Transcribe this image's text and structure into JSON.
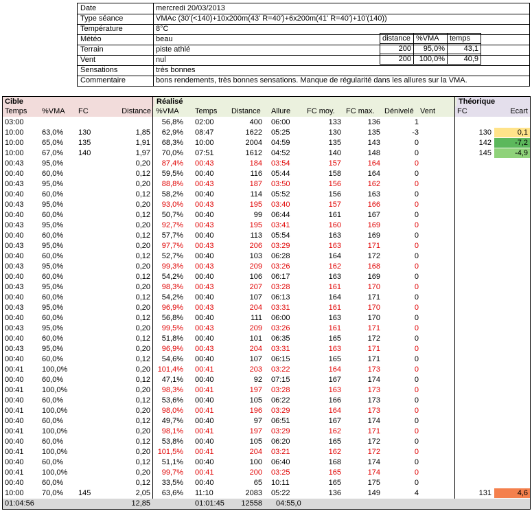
{
  "info": {
    "labels": [
      "Date",
      "Type séance",
      "Température",
      "Météo",
      "Terrain",
      "Vent",
      "Sensations",
      "Commentaire"
    ],
    "values": [
      "mercredi 20/03/2013",
      "VMAc (30'(<140)+10x200m(43' R=40')+6x200m(41' R=40')+10'(140))",
      "8°C",
      "beau",
      "piste athlé",
      "nul",
      "très bonnes",
      "bons rendements, très bonnes sensations. Manque de régularité dans les allures sur la VMA."
    ]
  },
  "mini": {
    "headers": [
      "distance",
      "%VMA",
      "temps"
    ],
    "rows": [
      [
        "200",
        "95,0%",
        "43,1"
      ],
      [
        "200",
        "100,0%",
        "40,9"
      ]
    ]
  },
  "sections": {
    "cible": "Cible",
    "realise": "Réalisé",
    "theorique": "Théorique"
  },
  "headers": {
    "cible": [
      "Temps",
      "%VMA",
      "FC",
      "Distance"
    ],
    "realise": [
      "%VMA",
      "Temps",
      "Distance",
      "Allure",
      "FC moy.",
      "FC max.",
      "Dénivelé",
      "Vent"
    ],
    "theorique": [
      "FC",
      "Ecart"
    ]
  },
  "rows": [
    {
      "c": [
        "03:00",
        "",
        "",
        ""
      ],
      "r": [
        "56,8%",
        "02:00",
        "400",
        "06:00",
        "133",
        "136",
        "1",
        ""
      ],
      "red": false,
      "t": [
        "",
        ""
      ]
    },
    {
      "c": [
        "10:00",
        "63,0%",
        "130",
        "1,85"
      ],
      "r": [
        "62,9%",
        "08:47",
        "1622",
        "05:25",
        "130",
        "135",
        "-3",
        ""
      ],
      "red": false,
      "t": [
        "130",
        "0,1"
      ]
    },
    {
      "c": [
        "10:00",
        "65,0%",
        "135",
        "1,91"
      ],
      "r": [
        "68,3%",
        "10:00",
        "2004",
        "04:59",
        "135",
        "143",
        "0",
        ""
      ],
      "red": false,
      "t": [
        "142",
        "-7,2"
      ]
    },
    {
      "c": [
        "10:00",
        "67,0%",
        "140",
        "1,97"
      ],
      "r": [
        "70,0%",
        "07:51",
        "1612",
        "04:52",
        "140",
        "148",
        "0",
        ""
      ],
      "red": false,
      "t": [
        "145",
        "-4,9"
      ]
    },
    {
      "c": [
        "00:43",
        "95,0%",
        "",
        "0,20"
      ],
      "r": [
        "87,4%",
        "00:43",
        "184",
        "03:54",
        "157",
        "164",
        "0",
        ""
      ],
      "red": true,
      "t": [
        "",
        ""
      ]
    },
    {
      "c": [
        "00:40",
        "60,0%",
        "",
        "0,12"
      ],
      "r": [
        "59,5%",
        "00:40",
        "116",
        "05:44",
        "158",
        "164",
        "0",
        ""
      ],
      "red": false,
      "t": [
        "",
        ""
      ]
    },
    {
      "c": [
        "00:43",
        "95,0%",
        "",
        "0,20"
      ],
      "r": [
        "88,8%",
        "00:43",
        "187",
        "03:50",
        "156",
        "162",
        "0",
        ""
      ],
      "red": true,
      "t": [
        "",
        ""
      ]
    },
    {
      "c": [
        "00:40",
        "60,0%",
        "",
        "0,12"
      ],
      "r": [
        "58,2%",
        "00:40",
        "114",
        "05:52",
        "156",
        "163",
        "0",
        ""
      ],
      "red": false,
      "t": [
        "",
        ""
      ]
    },
    {
      "c": [
        "00:43",
        "95,0%",
        "",
        "0,20"
      ],
      "r": [
        "93,0%",
        "00:43",
        "195",
        "03:40",
        "157",
        "166",
        "0",
        ""
      ],
      "red": true,
      "t": [
        "",
        ""
      ]
    },
    {
      "c": [
        "00:40",
        "60,0%",
        "",
        "0,12"
      ],
      "r": [
        "50,7%",
        "00:40",
        "99",
        "06:44",
        "161",
        "167",
        "0",
        ""
      ],
      "red": false,
      "t": [
        "",
        ""
      ]
    },
    {
      "c": [
        "00:43",
        "95,0%",
        "",
        "0,20"
      ],
      "r": [
        "92,7%",
        "00:43",
        "195",
        "03:41",
        "160",
        "169",
        "0",
        ""
      ],
      "red": true,
      "t": [
        "",
        ""
      ]
    },
    {
      "c": [
        "00:40",
        "60,0%",
        "",
        "0,12"
      ],
      "r": [
        "57,7%",
        "00:40",
        "113",
        "05:54",
        "163",
        "169",
        "0",
        ""
      ],
      "red": false,
      "t": [
        "",
        ""
      ]
    },
    {
      "c": [
        "00:43",
        "95,0%",
        "",
        "0,20"
      ],
      "r": [
        "97,7%",
        "00:43",
        "206",
        "03:29",
        "163",
        "171",
        "0",
        ""
      ],
      "red": true,
      "t": [
        "",
        ""
      ]
    },
    {
      "c": [
        "00:40",
        "60,0%",
        "",
        "0,12"
      ],
      "r": [
        "52,7%",
        "00:40",
        "103",
        "06:28",
        "164",
        "172",
        "0",
        ""
      ],
      "red": false,
      "t": [
        "",
        ""
      ]
    },
    {
      "c": [
        "00:43",
        "95,0%",
        "",
        "0,20"
      ],
      "r": [
        "99,3%",
        "00:43",
        "209",
        "03:26",
        "162",
        "168",
        "0",
        ""
      ],
      "red": true,
      "t": [
        "",
        ""
      ]
    },
    {
      "c": [
        "00:40",
        "60,0%",
        "",
        "0,12"
      ],
      "r": [
        "54,2%",
        "00:40",
        "106",
        "06:17",
        "163",
        "169",
        "0",
        ""
      ],
      "red": false,
      "t": [
        "",
        ""
      ]
    },
    {
      "c": [
        "00:43",
        "95,0%",
        "",
        "0,20"
      ],
      "r": [
        "98,3%",
        "00:43",
        "207",
        "03:28",
        "161",
        "170",
        "0",
        ""
      ],
      "red": true,
      "t": [
        "",
        ""
      ]
    },
    {
      "c": [
        "00:40",
        "60,0%",
        "",
        "0,12"
      ],
      "r": [
        "54,2%",
        "00:40",
        "107",
        "06:13",
        "164",
        "171",
        "0",
        ""
      ],
      "red": false,
      "t": [
        "",
        ""
      ]
    },
    {
      "c": [
        "00:43",
        "95,0%",
        "",
        "0,20"
      ],
      "r": [
        "96,9%",
        "00:43",
        "204",
        "03:31",
        "161",
        "170",
        "0",
        ""
      ],
      "red": true,
      "t": [
        "",
        ""
      ]
    },
    {
      "c": [
        "00:40",
        "60,0%",
        "",
        "0,12"
      ],
      "r": [
        "56,8%",
        "00:40",
        "111",
        "06:00",
        "163",
        "170",
        "0",
        ""
      ],
      "red": false,
      "t": [
        "",
        ""
      ]
    },
    {
      "c": [
        "00:43",
        "95,0%",
        "",
        "0,20"
      ],
      "r": [
        "99,5%",
        "00:43",
        "209",
        "03:26",
        "161",
        "171",
        "0",
        ""
      ],
      "red": true,
      "t": [
        "",
        ""
      ]
    },
    {
      "c": [
        "00:40",
        "60,0%",
        "",
        "0,12"
      ],
      "r": [
        "51,8%",
        "00:40",
        "101",
        "06:35",
        "165",
        "172",
        "0",
        ""
      ],
      "red": false,
      "t": [
        "",
        ""
      ]
    },
    {
      "c": [
        "00:43",
        "95,0%",
        "",
        "0,20"
      ],
      "r": [
        "96,9%",
        "00:43",
        "204",
        "03:31",
        "163",
        "171",
        "0",
        ""
      ],
      "red": true,
      "t": [
        "",
        ""
      ]
    },
    {
      "c": [
        "00:40",
        "60,0%",
        "",
        "0,12"
      ],
      "r": [
        "54,6%",
        "00:40",
        "107",
        "06:15",
        "165",
        "171",
        "0",
        ""
      ],
      "red": false,
      "t": [
        "",
        ""
      ]
    },
    {
      "c": [
        "00:41",
        "100,0%",
        "",
        "0,20"
      ],
      "r": [
        "101,4%",
        "00:41",
        "203",
        "03:22",
        "164",
        "173",
        "0",
        ""
      ],
      "red": true,
      "t": [
        "",
        ""
      ]
    },
    {
      "c": [
        "00:40",
        "60,0%",
        "",
        "0,12"
      ],
      "r": [
        "47,1%",
        "00:40",
        "92",
        "07:15",
        "167",
        "174",
        "0",
        ""
      ],
      "red": false,
      "t": [
        "",
        ""
      ]
    },
    {
      "c": [
        "00:41",
        "100,0%",
        "",
        "0,20"
      ],
      "r": [
        "98,3%",
        "00:41",
        "197",
        "03:28",
        "163",
        "173",
        "0",
        ""
      ],
      "red": true,
      "t": [
        "",
        ""
      ]
    },
    {
      "c": [
        "00:40",
        "60,0%",
        "",
        "0,12"
      ],
      "r": [
        "53,6%",
        "00:40",
        "105",
        "06:22",
        "166",
        "173",
        "0",
        ""
      ],
      "red": false,
      "t": [
        "",
        ""
      ]
    },
    {
      "c": [
        "00:41",
        "100,0%",
        "",
        "0,20"
      ],
      "r": [
        "98,0%",
        "00:41",
        "196",
        "03:29",
        "164",
        "173",
        "0",
        ""
      ],
      "red": true,
      "t": [
        "",
        ""
      ]
    },
    {
      "c": [
        "00:40",
        "60,0%",
        "",
        "0,12"
      ],
      "r": [
        "49,7%",
        "00:40",
        "97",
        "06:51",
        "167",
        "174",
        "0",
        ""
      ],
      "red": false,
      "t": [
        "",
        ""
      ]
    },
    {
      "c": [
        "00:41",
        "100,0%",
        "",
        "0,20"
      ],
      "r": [
        "98,1%",
        "00:41",
        "197",
        "03:29",
        "162",
        "171",
        "0",
        ""
      ],
      "red": true,
      "t": [
        "",
        ""
      ]
    },
    {
      "c": [
        "00:40",
        "60,0%",
        "",
        "0,12"
      ],
      "r": [
        "53,8%",
        "00:40",
        "105",
        "06:20",
        "165",
        "172",
        "0",
        ""
      ],
      "red": false,
      "t": [
        "",
        ""
      ]
    },
    {
      "c": [
        "00:41",
        "100,0%",
        "",
        "0,20"
      ],
      "r": [
        "101,5%",
        "00:41",
        "204",
        "03:21",
        "162",
        "172",
        "0",
        ""
      ],
      "red": true,
      "t": [
        "",
        ""
      ]
    },
    {
      "c": [
        "00:40",
        "60,0%",
        "",
        "0,12"
      ],
      "r": [
        "51,1%",
        "00:40",
        "100",
        "06:40",
        "168",
        "174",
        "0",
        ""
      ],
      "red": false,
      "t": [
        "",
        ""
      ]
    },
    {
      "c": [
        "00:41",
        "100,0%",
        "",
        "0,20"
      ],
      "r": [
        "99,7%",
        "00:41",
        "200",
        "03:25",
        "165",
        "174",
        "0",
        ""
      ],
      "red": true,
      "t": [
        "",
        ""
      ]
    },
    {
      "c": [
        "00:40",
        "60,0%",
        "",
        "0,12"
      ],
      "r": [
        "33,5%",
        "00:40",
        "65",
        "10:11",
        "165",
        "175",
        "0",
        ""
      ],
      "red": false,
      "t": [
        "",
        ""
      ]
    },
    {
      "c": [
        "10:00",
        "70,0%",
        "145",
        "2,05"
      ],
      "r": [
        "63,6%",
        "11:10",
        "2083",
        "05:22",
        "136",
        "149",
        "4",
        ""
      ],
      "red": false,
      "t": [
        "131",
        "4,6"
      ]
    }
  ],
  "total": {
    "c": [
      "01:04:56",
      "",
      "",
      "12,85"
    ],
    "r": [
      "",
      "01:01:45",
      "12558",
      "04:55,0",
      "",
      "",
      "",
      ""
    ]
  },
  "colors": {
    "cible_bg": "#f2dcdb",
    "realise_bg": "#ebf1de",
    "theorique_bg": "#e4dfec",
    "ecart_yellow": "#ffe38a",
    "ecart_green_dark": "#5cb85c",
    "ecart_green_light": "#8fd27a",
    "ecart_orange": "#f4804d"
  }
}
